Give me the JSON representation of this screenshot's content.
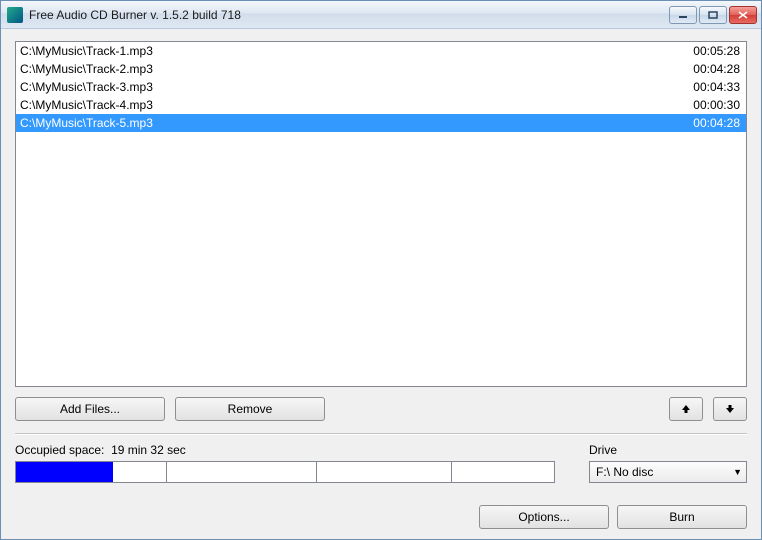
{
  "window": {
    "title": "Free Audio CD Burner  v. 1.5.2 build 718"
  },
  "tracks": [
    {
      "path": "C:\\MyMusic\\Track-1.mp3",
      "duration": "00:05:28",
      "selected": false
    },
    {
      "path": "C:\\MyMusic\\Track-2.mp3",
      "duration": "00:04:28",
      "selected": false
    },
    {
      "path": "C:\\MyMusic\\Track-3.mp3",
      "duration": "00:04:33",
      "selected": false
    },
    {
      "path": "C:\\MyMusic\\Track-4.mp3",
      "duration": "00:00:30",
      "selected": false
    },
    {
      "path": "C:\\MyMusic\\Track-5.mp3",
      "duration": "00:04:28",
      "selected": true
    }
  ],
  "buttons": {
    "add_files": "Add Files...",
    "remove": "Remove",
    "options": "Options...",
    "burn": "Burn"
  },
  "status": {
    "occupied_label": "Occupied space:",
    "occupied_value": "19 min 32 sec",
    "progress_percent": 18,
    "segments": [
      28,
      28,
      25,
      19
    ]
  },
  "drive": {
    "label": "Drive",
    "value": "F:\\ No disc"
  }
}
